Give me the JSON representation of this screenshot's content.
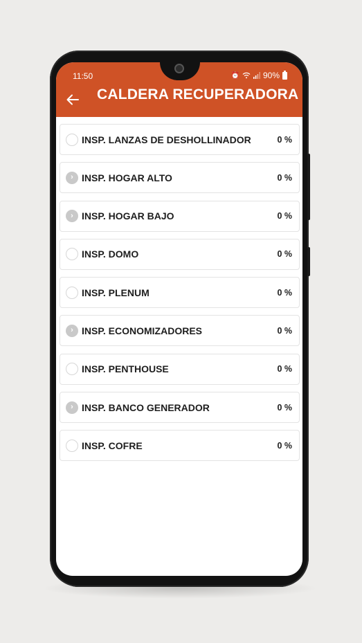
{
  "status_bar": {
    "time": "11:50",
    "battery": "90%"
  },
  "header": {
    "title": "CALDERA RECUPERADORA",
    "accent_color": "#cf5226"
  },
  "items": [
    {
      "label": "INSP. LANZAS DE DESHOLLINADOR",
      "percent": "0 %",
      "icon": "radio-empty"
    },
    {
      "label": "INSP. HOGAR ALTO",
      "percent": "0 %",
      "icon": "chevron-right"
    },
    {
      "label": "INSP. HOGAR BAJO",
      "percent": "0 %",
      "icon": "chevron-right"
    },
    {
      "label": "INSP. DOMO",
      "percent": "0 %",
      "icon": "radio-empty"
    },
    {
      "label": "INSP. PLENUM",
      "percent": "0 %",
      "icon": "radio-empty"
    },
    {
      "label": "INSP. ECONOMIZADORES",
      "percent": "0 %",
      "icon": "chevron-right"
    },
    {
      "label": "INSP. PENTHOUSE",
      "percent": "0 %",
      "icon": "radio-empty"
    },
    {
      "label": "INSP. BANCO GENERADOR",
      "percent": "0 %",
      "icon": "chevron-right"
    },
    {
      "label": "INSP. COFRE",
      "percent": "0 %",
      "icon": "radio-empty"
    }
  ]
}
